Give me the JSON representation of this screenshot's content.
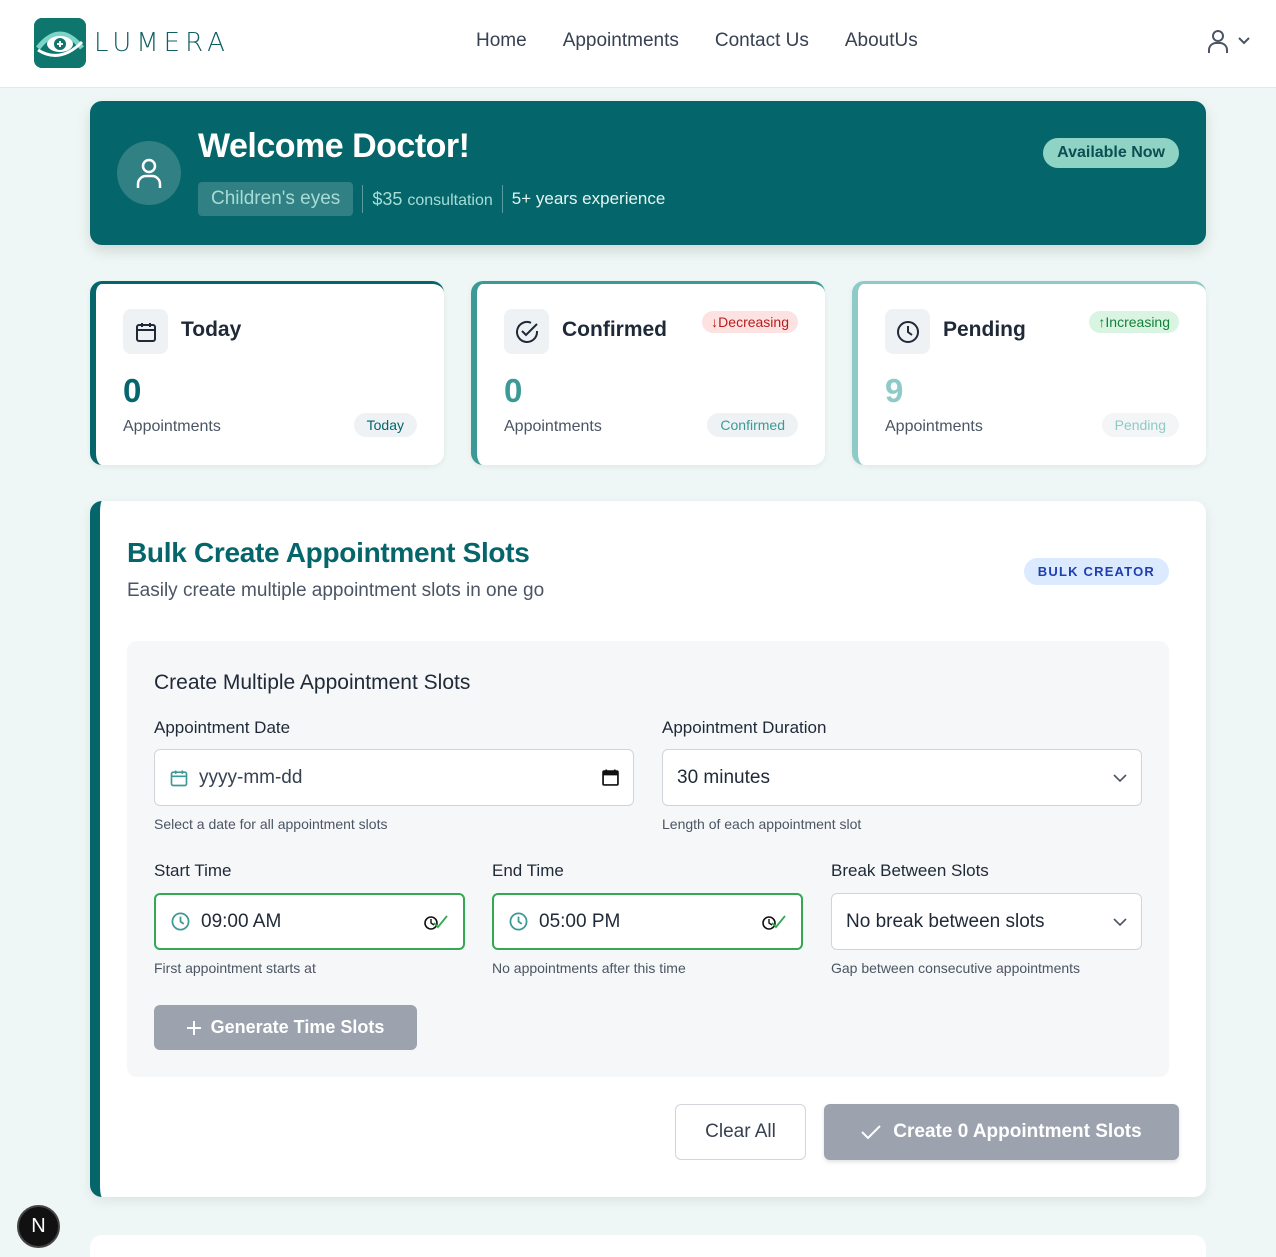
{
  "nav": {
    "brand": "LUMERA",
    "links": [
      "Home",
      "Appointments",
      "Contact Us",
      "AboutUs"
    ],
    "user_icon": "user-icon"
  },
  "banner": {
    "title": "Welcome Doctor!",
    "specialty": "Children's eyes",
    "fee_amount": "$35",
    "fee_label": "consultation",
    "experience": "5+ years experience",
    "status": "Available Now"
  },
  "stats": [
    {
      "title": "Today",
      "value": "0",
      "sub": "Appointments",
      "pill": "Today",
      "trend": "",
      "icon": "calendar-icon",
      "value_color": "#04656a"
    },
    {
      "title": "Confirmed",
      "value": "0",
      "sub": "Appointments",
      "pill": "Confirmed",
      "trend": "↓Decreasing",
      "icon": "check-circle-icon",
      "value_color": "#3c9a96"
    },
    {
      "title": "Pending",
      "value": "9",
      "sub": "Appointments",
      "pill": "Pending",
      "trend": "↑Increasing",
      "icon": "clock-icon",
      "value_color": "#8ecbc8"
    }
  ],
  "bulk": {
    "title": "Bulk Create Appointment Slots",
    "subtitle": "Easily create multiple appointment slots in one go",
    "badge": "BULK CREATOR",
    "form_heading": "Create Multiple Appointment Slots",
    "date": {
      "label": "Appointment Date",
      "value": "yyyy-mm-dd",
      "help": "Select a date for all appointment slots"
    },
    "duration": {
      "label": "Appointment Duration",
      "value": "30 minutes",
      "help": "Length of each appointment slot"
    },
    "start": {
      "label": "Start Time",
      "value": "09:00 AM",
      "help": "First appointment starts at"
    },
    "end": {
      "label": "End Time",
      "value": "05:00 PM",
      "help": "No appointments after this time"
    },
    "break": {
      "label": "Break Between Slots",
      "value": "No break between slots",
      "help": "Gap between consecutive appointments"
    },
    "generate": "Generate Time Slots",
    "clear": "Clear All",
    "create": "Create 0 Appointment Slots"
  },
  "devtools": "N",
  "colors": {
    "primary": "#04656a",
    "accent": "#8fd3c5",
    "disabled": "#9ca3af",
    "valid": "#34a853"
  }
}
